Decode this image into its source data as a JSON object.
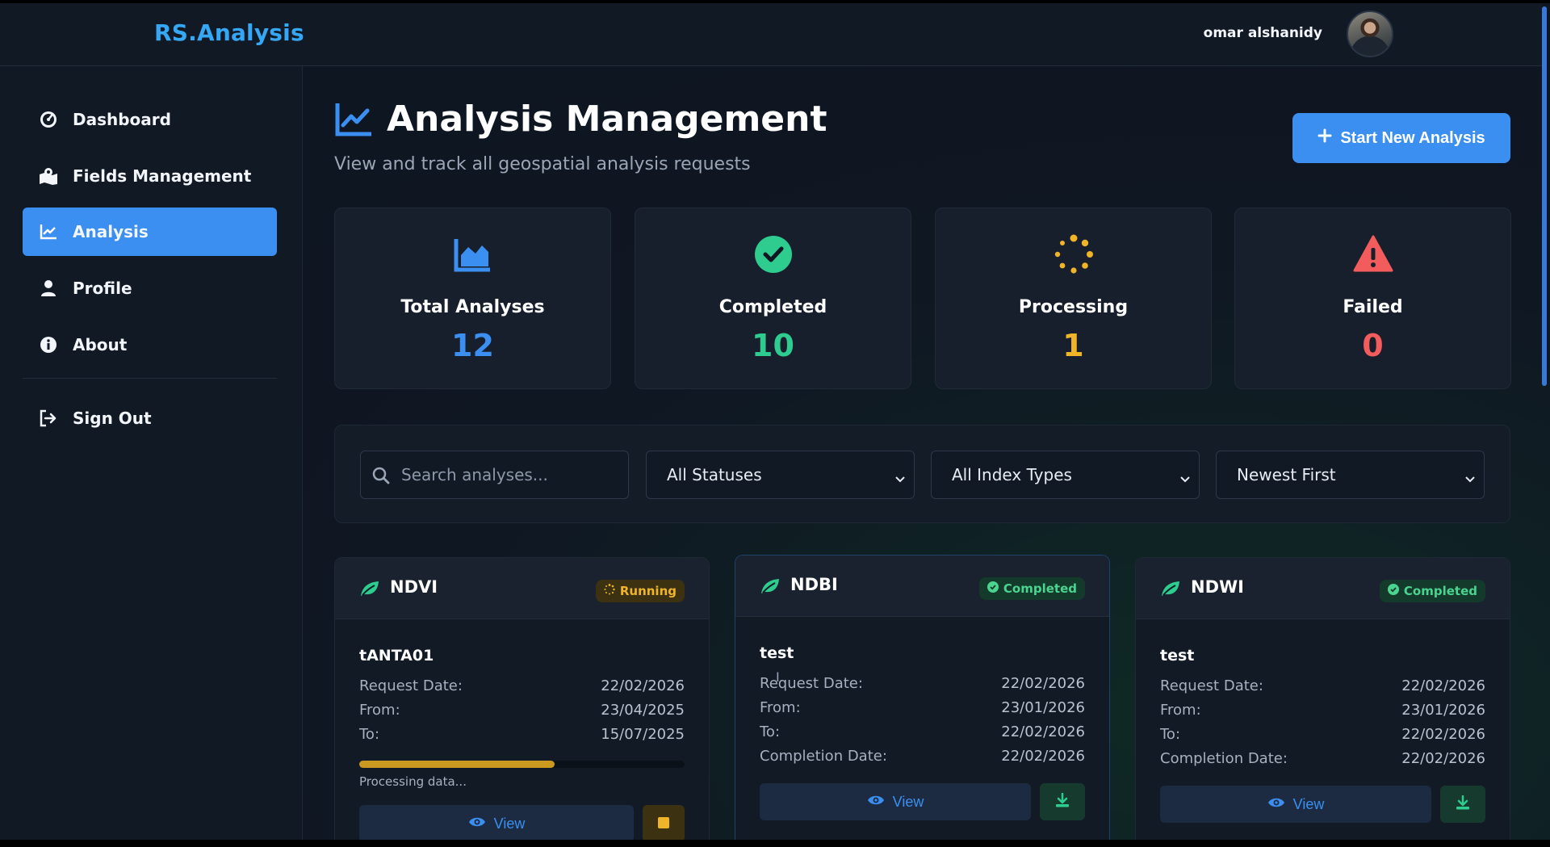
{
  "header": {
    "brand": "RS.Analysis",
    "user_name": "omar alshanidy"
  },
  "sidebar": {
    "items": [
      {
        "label": "Dashboard",
        "icon": "gauge-icon"
      },
      {
        "label": "Fields Management",
        "icon": "map-icon"
      },
      {
        "label": "Analysis",
        "icon": "chart-line-icon",
        "active": true
      },
      {
        "label": "Profile",
        "icon": "user-icon"
      },
      {
        "label": "About",
        "icon": "info-icon"
      },
      {
        "label": "Sign Out",
        "icon": "sign-out-icon"
      }
    ]
  },
  "page": {
    "title": "Analysis Management",
    "subtitle": "View and track all geospatial analysis requests",
    "new_button": "Start New Analysis"
  },
  "stats": [
    {
      "label": "Total Analyses",
      "value": "12",
      "color": "#3b8ff0",
      "icon": "area-chart-icon"
    },
    {
      "label": "Completed",
      "value": "10",
      "color": "#2ecc8f",
      "icon": "check-circle-icon"
    },
    {
      "label": "Processing",
      "value": "1",
      "color": "#f0b429",
      "icon": "spinner-icon"
    },
    {
      "label": "Failed",
      "value": "0",
      "color": "#f25c5c",
      "icon": "warning-icon"
    }
  ],
  "filters": {
    "search_placeholder": "Search analyses...",
    "status": "All Statuses",
    "index_type": "All Index Types",
    "sort": "Newest First"
  },
  "cards": [
    {
      "index": "NDVI",
      "status": "Running",
      "name": "tANTA01",
      "request_date_label": "Request Date:",
      "request_date": "22/02/2026",
      "from_label": "From:",
      "from": "23/04/2025",
      "to_label": "To:",
      "to": "15/07/2025",
      "progress": 0.6,
      "progress_text": "Processing data...",
      "view_label": "View"
    },
    {
      "index": "NDBI",
      "status": "Completed",
      "name": "test",
      "request_date_label": "Request Date:",
      "request_date": "22/02/2026",
      "from_label": "From:",
      "from": "23/01/2026",
      "to_label": "To:",
      "to": "22/02/2026",
      "completion_label": "Completion Date:",
      "completion": "22/02/2026",
      "view_label": "View"
    },
    {
      "index": "NDWI",
      "status": "Completed",
      "name": "test",
      "request_date_label": "Request Date:",
      "request_date": "22/02/2026",
      "from_label": "From:",
      "from": "23/01/2026",
      "to_label": "To:",
      "to": "22/02/2026",
      "completion_label": "Completion Date:",
      "completion": "22/02/2026",
      "view_label": "View"
    }
  ],
  "colors": {
    "accent": "#3b8ff0",
    "brand": "#35a8f5",
    "success": "#2ecc8f",
    "warning": "#f0b429",
    "danger": "#f25c5c"
  }
}
